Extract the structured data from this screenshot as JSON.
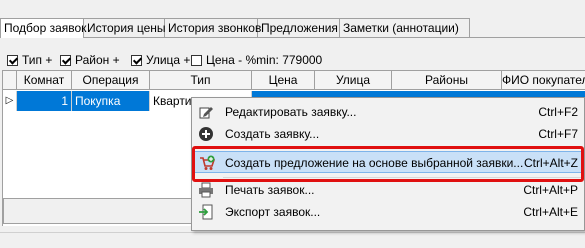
{
  "tabs": [
    {
      "label": "Подбор заявок"
    },
    {
      "label": "История цены"
    },
    {
      "label": "История звонков"
    },
    {
      "label": "Предложения"
    },
    {
      "label": "Заметки (аннотации)"
    }
  ],
  "filters": {
    "type_label": "Тип +",
    "district_label": "Район +",
    "street_label": "Улица +",
    "price_label": "Цена - %min: 779000",
    "checked": {
      "type": true,
      "district": true,
      "street": true,
      "price": false
    }
  },
  "grid": {
    "columns": [
      "Комнат",
      "Операция",
      "Тип",
      "Цена",
      "Улица",
      "Районы",
      "ФИО покупателя"
    ],
    "row": {
      "rooms": "1",
      "operation": "Покупка",
      "type": "Квартир"
    }
  },
  "context_menu": {
    "items": [
      {
        "label": "Редактировать заявку...",
        "shortcut": "Ctrl+F2",
        "icon": "edit-icon"
      },
      {
        "label": "Создать заявку...",
        "shortcut": "Ctrl+F7",
        "icon": "add-icon"
      },
      {
        "label": "Создать предложение на основе выбранной заявки...",
        "shortcut": "Ctrl+Alt+Z",
        "icon": "cart-add-icon"
      },
      {
        "label": "Печать заявок...",
        "shortcut": "Ctrl+Alt+P",
        "icon": "printer-icon"
      },
      {
        "label": "Экспорт заявок...",
        "shortcut": "Ctrl+Alt+E",
        "icon": "export-icon"
      }
    ]
  },
  "colors": {
    "selection": "#0078d7",
    "highlight_box": "#e01010",
    "menu_hover": "#c9e0f7"
  }
}
